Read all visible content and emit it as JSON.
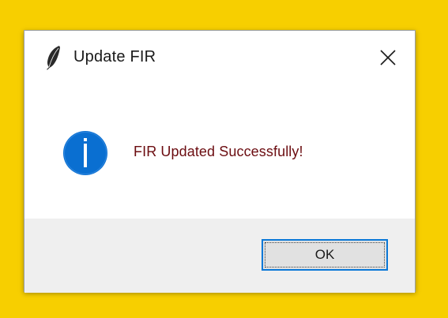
{
  "window": {
    "title": "Update FIR",
    "app_icon": "feather-icon",
    "close_icon": "close-icon"
  },
  "message": {
    "icon": "info-icon",
    "text": "FIR Updated Successfully!"
  },
  "buttons": {
    "ok_label": "OK"
  },
  "colors": {
    "background": "#f7cf00",
    "info_icon": "#0a6fd1",
    "message_text": "#6b0c10",
    "button_focus": "#0a78d7"
  }
}
